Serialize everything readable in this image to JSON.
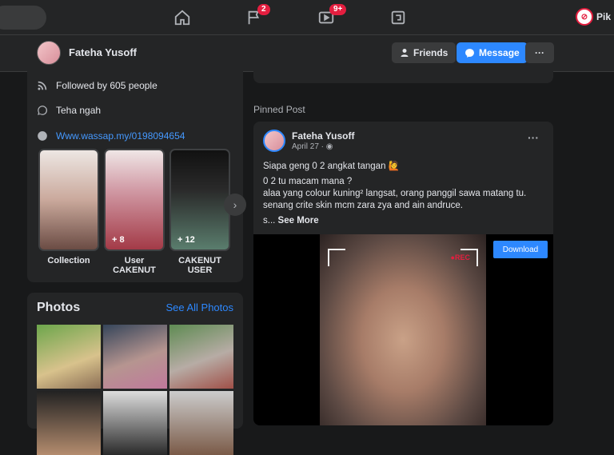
{
  "topbar": {
    "nav": [
      {
        "name": "home-icon"
      },
      {
        "name": "flag-icon",
        "badge": "2"
      },
      {
        "name": "watch-icon",
        "badge": "9+"
      },
      {
        "name": "gaming-icon"
      }
    ],
    "profile_name": "Pik"
  },
  "profile": {
    "name": "Fateha Yusoff",
    "friends_label": "Friends",
    "message_label": "Message",
    "more_label": "···"
  },
  "intro": {
    "followed_by": "Followed by 605 people",
    "bio": "Teha ngah",
    "website": "Www.wassap.my/0198094654",
    "highlights": [
      {
        "label": "Collection",
        "count": ""
      },
      {
        "label": "User CAKENUT",
        "count": "+ 8"
      },
      {
        "label": "CAKENUT USER",
        "count": "+ 12"
      }
    ]
  },
  "photos": {
    "title": "Photos",
    "see_all": "See All Photos"
  },
  "pinned": {
    "section_title": "Pinned Post",
    "author": "Fateha Yusoff",
    "date": "April 27 · ",
    "lines": [
      "Siapa geng 0 2 angkat tangan 🙋",
      "0 2 tu macam mana ?",
      "alaa yang colour kuning² langsat, orang panggil sawa matang tu.",
      "senang crite skin mcm zara zya and ain andruce."
    ],
    "see_more_prefix": "s... ",
    "see_more": "See More",
    "rec_label": "●REC",
    "download_label": "Download"
  },
  "colors": {
    "accent": "#2d88ff",
    "badge": "#e41e3f",
    "surface": "#242526",
    "background": "#18191a"
  }
}
